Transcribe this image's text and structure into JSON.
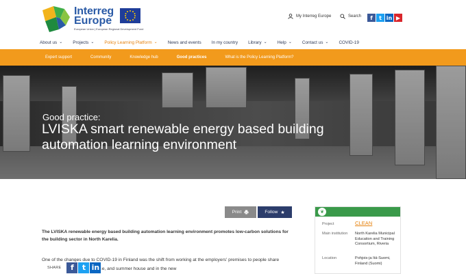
{
  "brand": {
    "name_line1": "Interreg",
    "name_line2": "Europe",
    "tagline": "European Union | European Regional Development Fund",
    "colors": {
      "blue": "#2a5aa6",
      "orange": "#f29a1c",
      "green": "#3a9a4a",
      "navy": "#2c3d6b"
    }
  },
  "utility": {
    "my_account": "My Interreg Europe",
    "search": "Search",
    "social": [
      {
        "icon": "facebook-icon",
        "glyph": "f"
      },
      {
        "icon": "twitter-icon",
        "glyph": "t"
      },
      {
        "icon": "linkedin-icon",
        "glyph": "in"
      },
      {
        "icon": "youtube-icon",
        "glyph": "▶"
      }
    ]
  },
  "nav": {
    "items": [
      {
        "label": "About us",
        "has_menu": true
      },
      {
        "label": "Projects",
        "has_menu": true
      },
      {
        "label": "Policy Learning Platform",
        "has_menu": true,
        "active": true
      },
      {
        "label": "News and events",
        "has_menu": false
      },
      {
        "label": "In my country",
        "has_menu": false
      },
      {
        "label": "Library",
        "has_menu": true
      },
      {
        "label": "Help",
        "has_menu": true
      },
      {
        "label": "Contact us",
        "has_menu": true
      },
      {
        "label": "COVID-19",
        "has_menu": false
      }
    ]
  },
  "subnav": {
    "items": [
      {
        "label": "Expert support"
      },
      {
        "label": "Community"
      },
      {
        "label": "Knowledge hub"
      },
      {
        "label": "Good practices",
        "active": true
      },
      {
        "label": "What is the Policy Learning Platform?"
      }
    ]
  },
  "hero": {
    "kicker": "Good practice:",
    "title": "LVISKA smart renewable energy based building automation learning environment"
  },
  "actions": {
    "print": "Print",
    "follow": "Follow"
  },
  "content": {
    "lead": "The LVISKA renewable energy based building automation learning environment promotes low-carbon solutions for the building sector in North Karelia.",
    "body": "One of the changes due to COVID-19 in Finland was the shift from working at the employers' premises to people share their time between home, office, and summer house and in the new"
  },
  "share": {
    "label": "SHARE"
  },
  "card": {
    "rows": [
      {
        "label": "Project",
        "value": "CLEAN",
        "link": true
      },
      {
        "label": "Main institution",
        "value": "North Karelia Municipal Education and Training Consortium, Riveria"
      },
      {
        "label": "Location",
        "value": "Pohjois-ja Itä-Suomi, Finland (Suomi)"
      }
    ]
  }
}
